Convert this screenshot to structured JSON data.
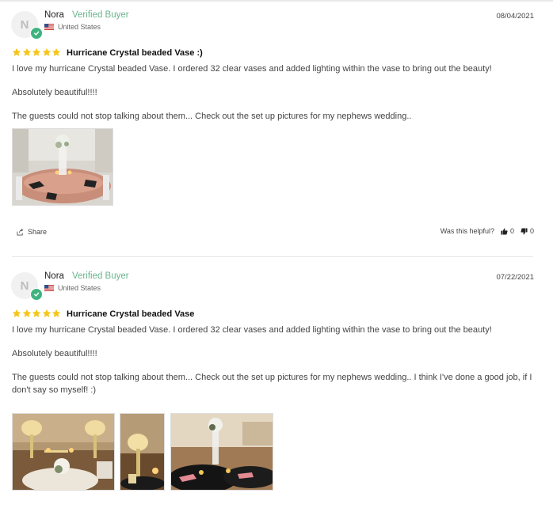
{
  "colors": {
    "star": "#f5c518",
    "verified": "#69b58c",
    "badge": "#3fb37f"
  },
  "reviews": [
    {
      "initial": "N",
      "name": "Nora",
      "verified": "Verified Buyer",
      "country": "United States",
      "date": "08/04/2021",
      "rating": 5,
      "title": "Hurricane Crystal beaded Vase :)",
      "paragraphs": [
        "I love my hurricane Crystal beaded Vase. I ordered 32 clear vases and added lighting within the vase to bring out the beauty!",
        "Absolutely beautiful!!!!",
        "The guests could not stop talking about them... Check out the set up pictures for my nephews wedding.."
      ],
      "photos": [
        "table-setting-photo"
      ],
      "share": "Share",
      "helpful": "Was this helpful?",
      "up": "0",
      "down": "0"
    },
    {
      "initial": "N",
      "name": "Nora",
      "verified": "Verified Buyer",
      "country": "United States",
      "date": "07/22/2021",
      "rating": 5,
      "title": "Hurricane Crystal beaded Vase",
      "paragraphs": [
        "I love my hurricane Crystal beaded Vase. I ordered 32 clear vases and added lighting within the vase to bring out the beauty!",
        "Absolutely beautiful!!!!",
        "The guests could not stop talking about them... Check out the set up pictures for my nephews wedding.. I think I've done a good job, if I don't say so myself! :)"
      ],
      "photos": [
        "ballroom-photo",
        "centerpiece-photo",
        "reception-photo"
      ]
    }
  ]
}
